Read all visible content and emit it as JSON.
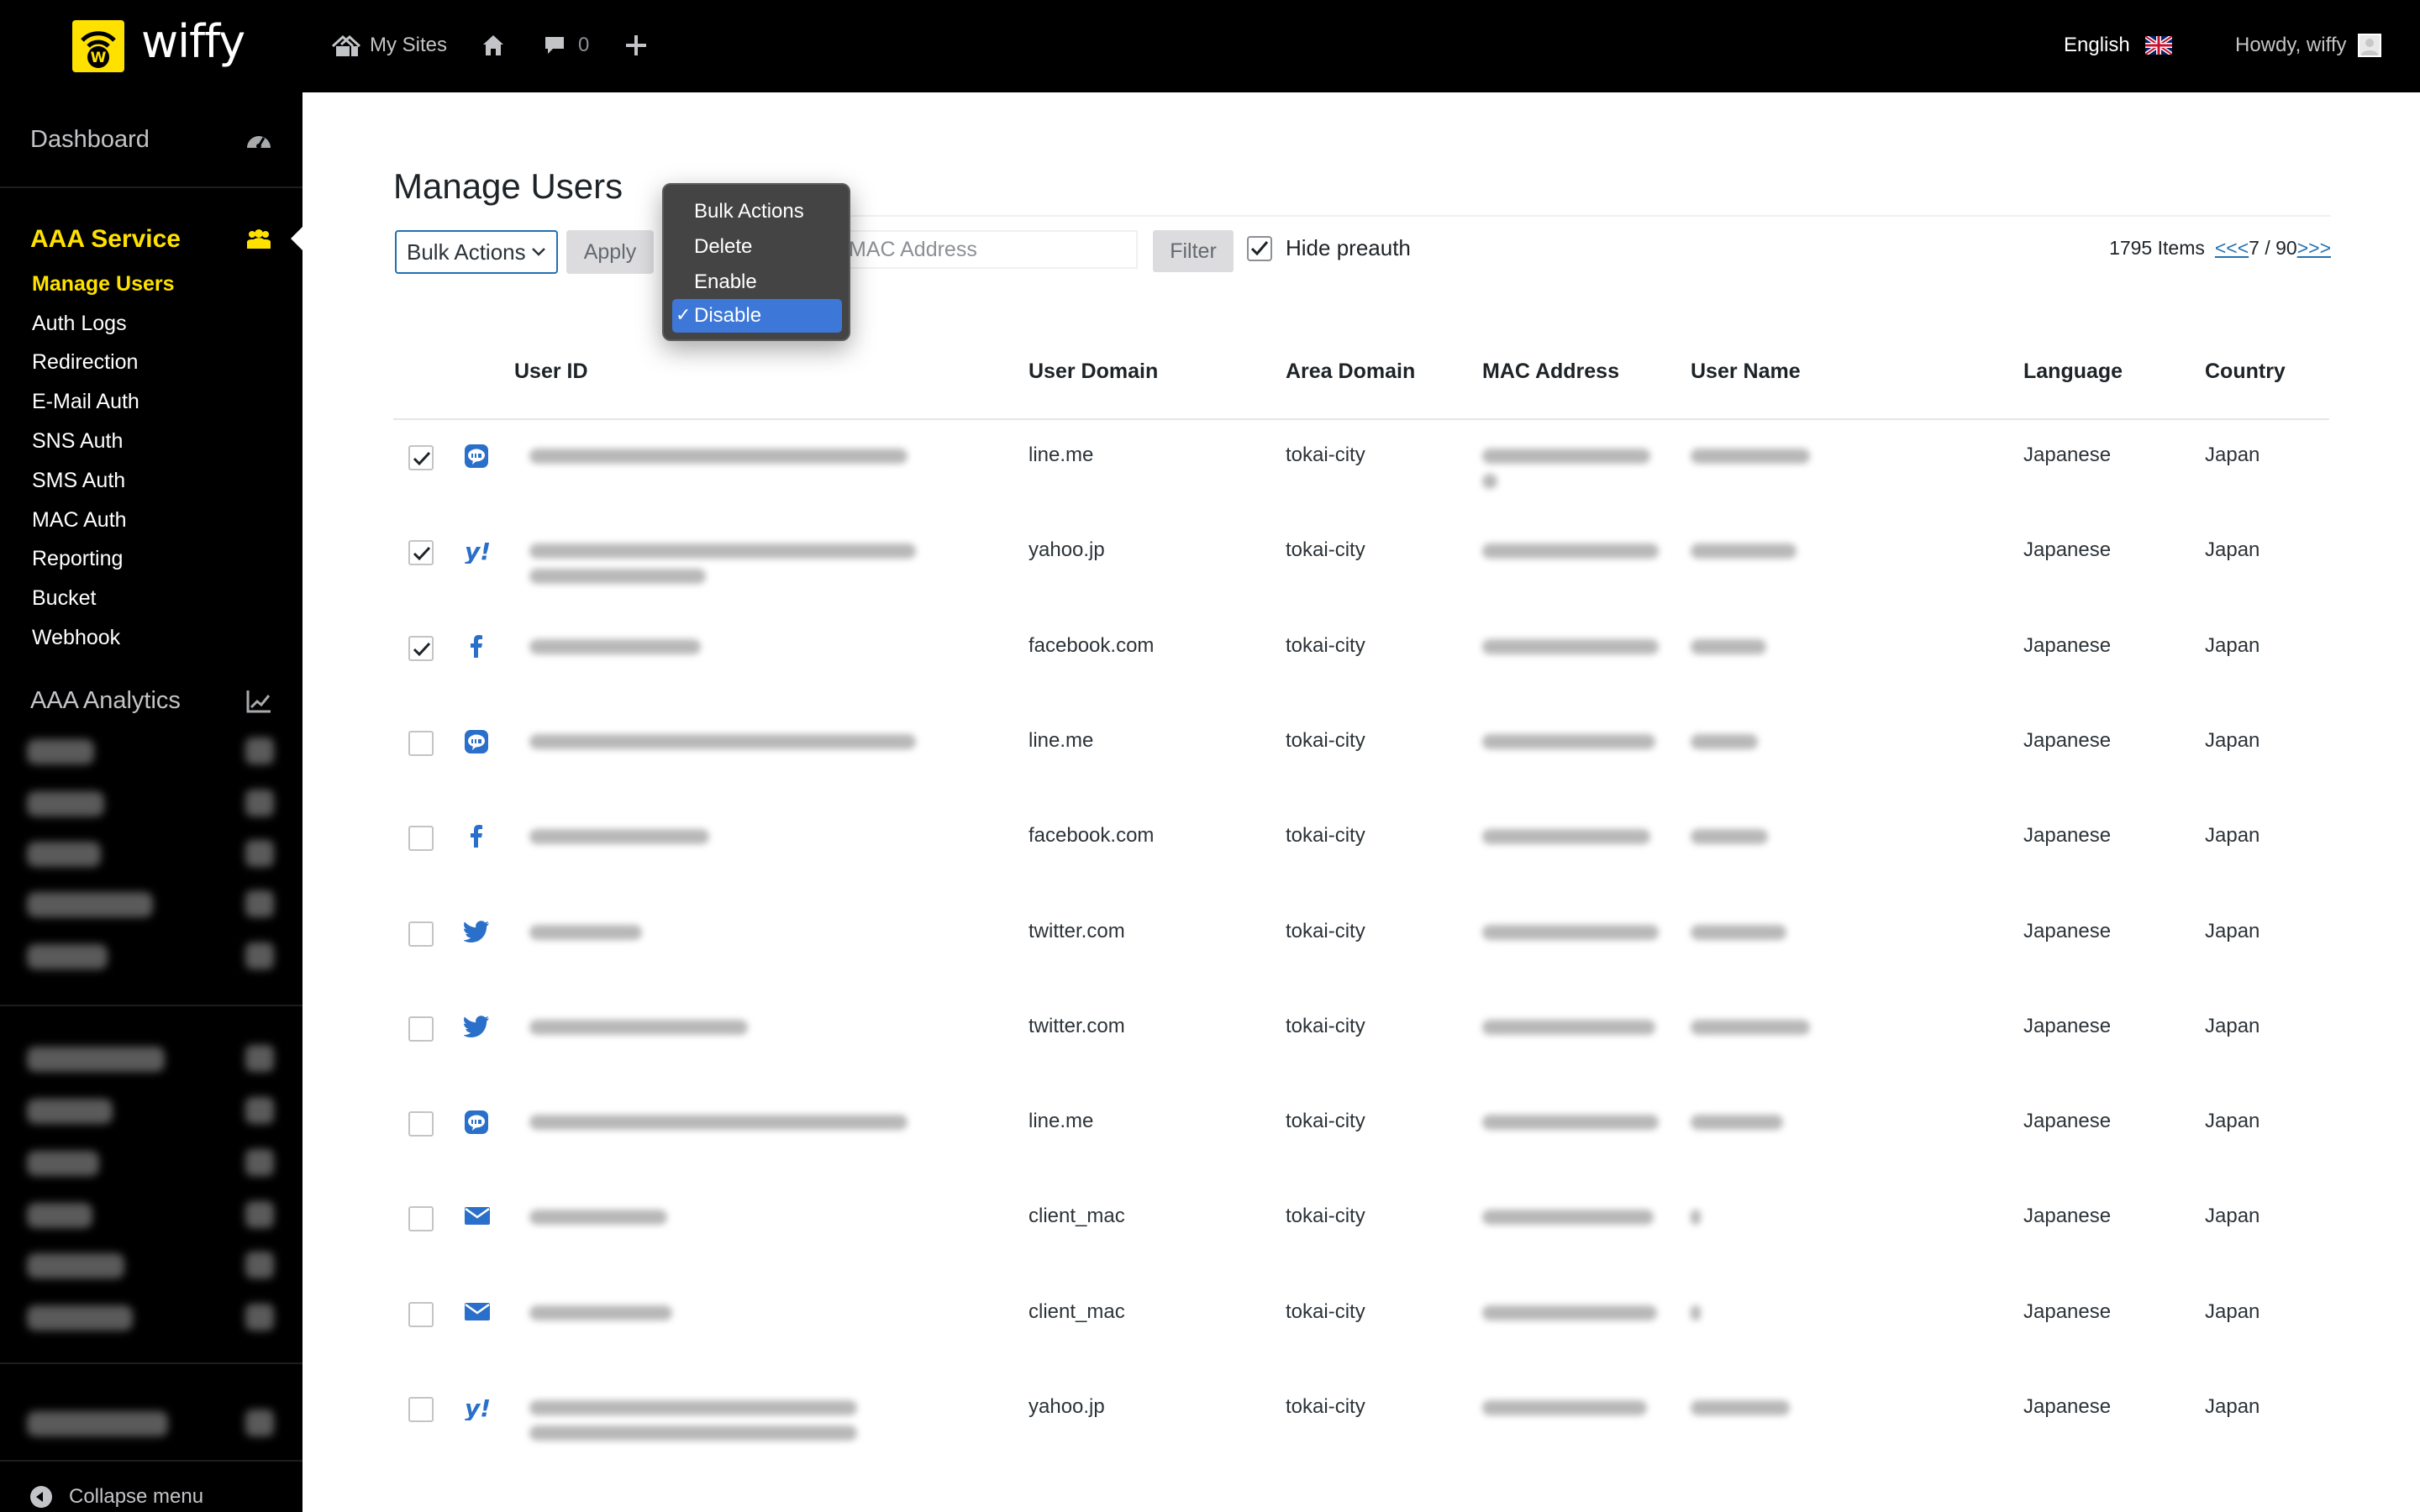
{
  "topbar": {
    "logo_text": "wiffy",
    "my_sites": "My Sites",
    "comments_count": "0",
    "language": "English",
    "howdy": "Howdy, wiffy"
  },
  "sidebar": {
    "dashboard": "Dashboard",
    "section": "AAA Service",
    "items": [
      "Manage Users",
      "Auth Logs",
      "Redirection",
      "E-Mail Auth",
      "SNS Auth",
      "SMS Auth",
      "MAC Auth",
      "Reporting",
      "Bucket",
      "Webhook"
    ],
    "active_item": "Manage Users",
    "analytics": "AAA Analytics",
    "collapse": "Collapse menu"
  },
  "page": {
    "title": "Manage Users",
    "bulk_select": "Bulk Actions",
    "apply": "Apply",
    "mac_placeholder": "MAC Address",
    "filter": "Filter",
    "hide_preauth": "Hide preauth",
    "hide_preauth_checked": true,
    "items_count": "1795 Items",
    "prev": "<<<",
    "page_info": "7 / 90",
    "next": ">>>"
  },
  "dropdown": {
    "options": [
      "Bulk Actions",
      "Delete",
      "Enable",
      "Disable"
    ],
    "selected": "Disable"
  },
  "table": {
    "columns": [
      "User ID",
      "User Domain",
      "Area Domain",
      "MAC Address",
      "User Name",
      "Language",
      "Country"
    ],
    "rows": [
      {
        "checked": true,
        "service": "line-icon",
        "domain": "line.me",
        "area": "tokai-city",
        "language": "Japanese",
        "country": "Japan"
      },
      {
        "checked": true,
        "service": "yahoo-icon",
        "domain": "yahoo.jp",
        "area": "tokai-city",
        "language": "Japanese",
        "country": "Japan"
      },
      {
        "checked": true,
        "service": "facebook-icon",
        "domain": "facebook.com",
        "area": "tokai-city",
        "language": "Japanese",
        "country": "Japan"
      },
      {
        "checked": false,
        "service": "line-icon",
        "domain": "line.me",
        "area": "tokai-city",
        "language": "Japanese",
        "country": "Japan"
      },
      {
        "checked": false,
        "service": "facebook-icon",
        "domain": "facebook.com",
        "area": "tokai-city",
        "language": "Japanese",
        "country": "Japan"
      },
      {
        "checked": false,
        "service": "twitter-icon",
        "domain": "twitter.com",
        "area": "tokai-city",
        "language": "Japanese",
        "country": "Japan"
      },
      {
        "checked": false,
        "service": "twitter-icon",
        "domain": "twitter.com",
        "area": "tokai-city",
        "language": "Japanese",
        "country": "Japan"
      },
      {
        "checked": false,
        "service": "line-icon",
        "domain": "line.me",
        "area": "tokai-city",
        "language": "Japanese",
        "country": "Japan"
      },
      {
        "checked": false,
        "service": "email-icon",
        "domain": "client_mac",
        "area": "tokai-city",
        "language": "Japanese",
        "country": "Japan"
      },
      {
        "checked": false,
        "service": "email-icon",
        "domain": "client_mac",
        "area": "tokai-city",
        "language": "Japanese",
        "country": "Japan"
      },
      {
        "checked": false,
        "service": "yahoo-icon",
        "domain": "yahoo.jp",
        "area": "tokai-city",
        "language": "Japanese",
        "country": "Japan"
      }
    ]
  },
  "colors": {
    "accent_yellow": "#ffe100",
    "link_blue": "#2271b1",
    "service_blue": "#2a6fc9",
    "selected_blue": "#3d78d8"
  }
}
